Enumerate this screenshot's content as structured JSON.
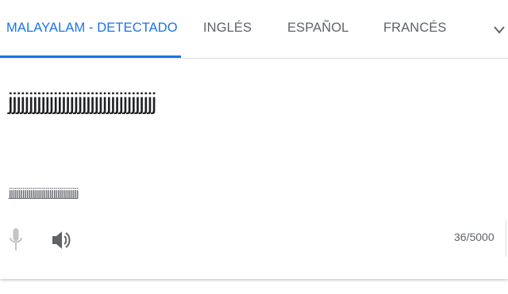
{
  "tabs": [
    {
      "label": "MALAYALAM - DETECTADO"
    },
    {
      "label": "INGLÉS"
    },
    {
      "label": "ESPAÑOL"
    },
    {
      "label": "FRANCÉS"
    }
  ],
  "more_icon": "chevron-down-icon",
  "source": {
    "text": "jjjjjjjjjjjjjjjjjjjjjjjjjjjjjjjjjjjj",
    "transliteration": "jjjjjjjjjjjjjjjjjjjjjjjjjjjjjjjjjjjj"
  },
  "toolbar": {
    "mic_icon": "microphone-icon",
    "speaker_icon": "speaker-icon",
    "char_count": "36/5000"
  },
  "colors": {
    "accent": "#1a73e8",
    "text_muted": "#5f6368",
    "text_main": "#202124",
    "mic_disabled": "#c4c4c4"
  }
}
